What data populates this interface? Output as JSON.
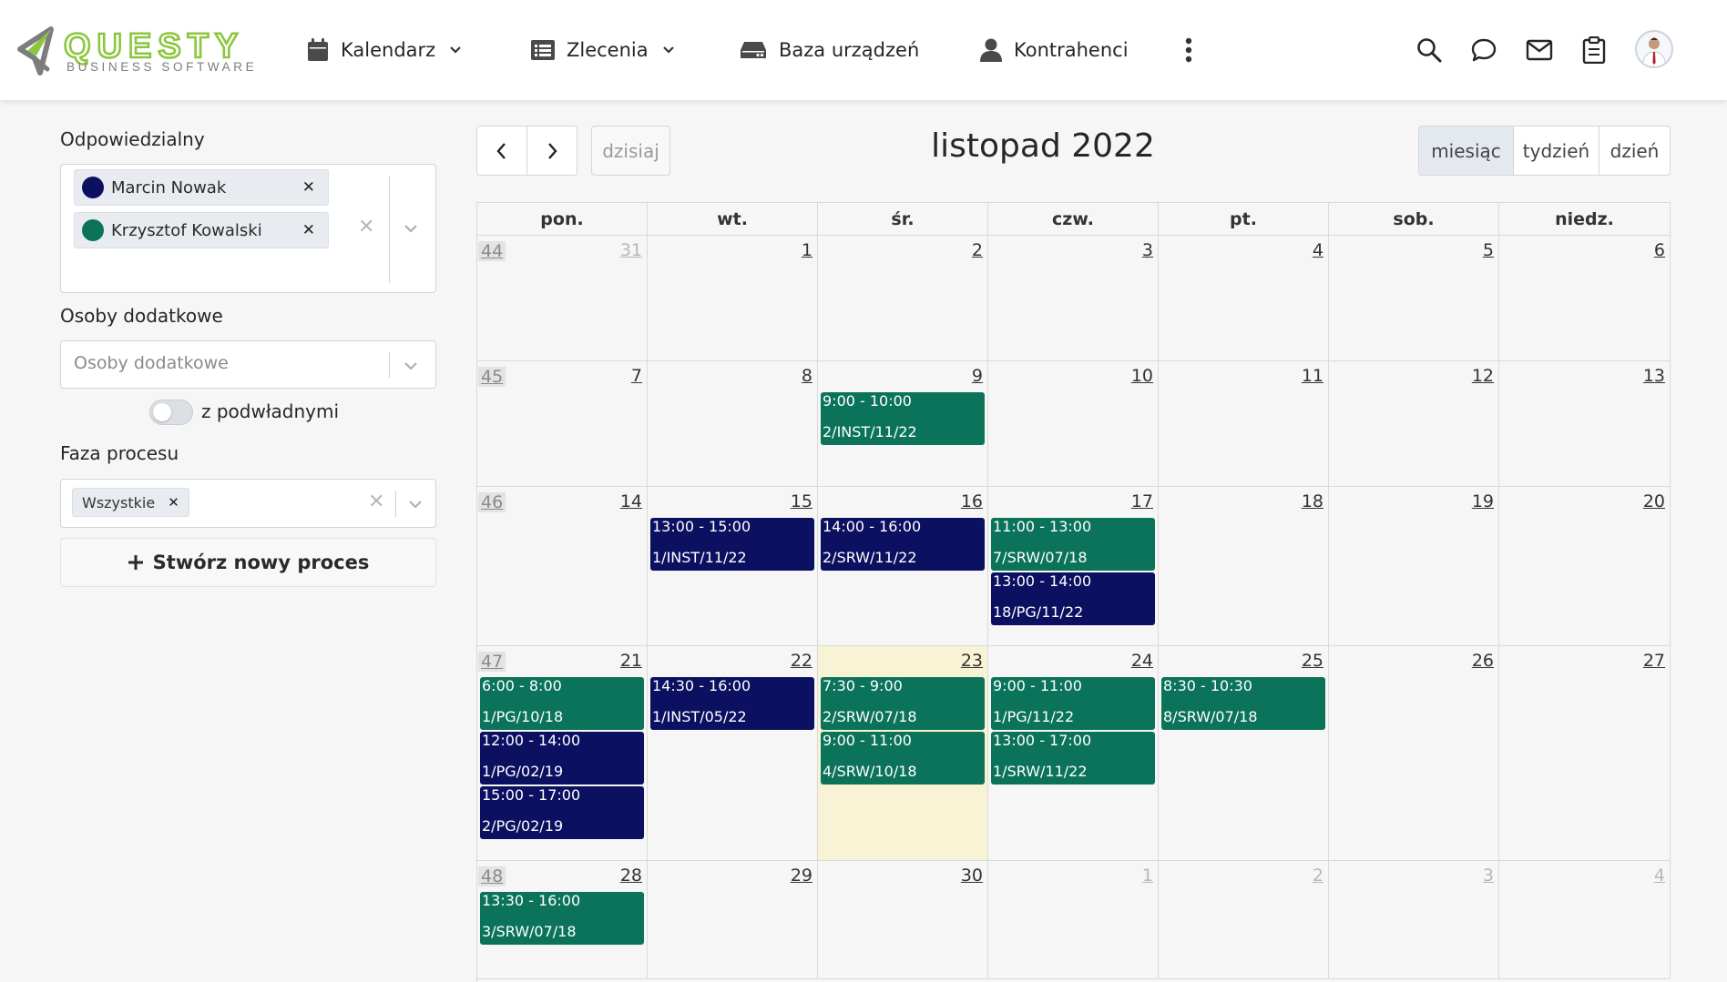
{
  "brand": {
    "name": "QUESTY",
    "tagline": "BUSINESS SOFTWARE",
    "green": "#8cc63f"
  },
  "nav": {
    "calendar": "Kalendarz",
    "orders": "Zlecenia",
    "devices": "Baza urządzeń",
    "contractors": "Kontrahenci"
  },
  "sidebar": {
    "responsible_label": "Odpowiedzialny",
    "responsible": [
      {
        "name": "Marcin Nowak",
        "color": "#0c1060"
      },
      {
        "name": "Krzysztof Kowalski",
        "color": "#0c735b"
      }
    ],
    "extra_people_label": "Osoby dodatkowe",
    "extra_people_placeholder": "Osoby dodatkowe",
    "subordinates_label": "z podwładnymi",
    "phase_label": "Faza procesu",
    "phase_tag": "Wszystkie",
    "create_button": "Stwórz nowy proces"
  },
  "toolbar": {
    "today": "dzisiaj",
    "title": "listopad 2022",
    "views": [
      "miesiąc",
      "tydzień",
      "dzień"
    ],
    "active_view": "miesiąc"
  },
  "calendar": {
    "days_of_week": [
      "pon.",
      "wt.",
      "śr.",
      "czw.",
      "pt.",
      "sob.",
      "niedz."
    ],
    "colors": {
      "green": "#0c735b",
      "navy": "#0c1060",
      "today": "#f9f3d6"
    },
    "weeks": [
      {
        "week": "44",
        "days": [
          {
            "d": "31",
            "other": true
          },
          {
            "d": "1"
          },
          {
            "d": "2"
          },
          {
            "d": "3"
          },
          {
            "d": "4"
          },
          {
            "d": "5"
          },
          {
            "d": "6"
          }
        ]
      },
      {
        "week": "45",
        "days": [
          {
            "d": "7"
          },
          {
            "d": "8"
          },
          {
            "d": "9",
            "events": [
              {
                "time": "9:00 - 10:00",
                "code": "2/INST/11/22",
                "color": "green"
              }
            ]
          },
          {
            "d": "10"
          },
          {
            "d": "11"
          },
          {
            "d": "12"
          },
          {
            "d": "13"
          }
        ]
      },
      {
        "week": "46",
        "days": [
          {
            "d": "14"
          },
          {
            "d": "15",
            "events": [
              {
                "time": "13:00 - 15:00",
                "code": "1/INST/11/22",
                "color": "navy"
              }
            ]
          },
          {
            "d": "16",
            "events": [
              {
                "time": "14:00 - 16:00",
                "code": "2/SRW/11/22",
                "color": "navy"
              }
            ]
          },
          {
            "d": "17",
            "events": [
              {
                "time": "11:00 - 13:00",
                "code": "7/SRW/07/18",
                "color": "green"
              },
              {
                "time": "13:00 - 14:00",
                "code": "18/PG/11/22",
                "color": "navy"
              }
            ]
          },
          {
            "d": "18"
          },
          {
            "d": "19"
          },
          {
            "d": "20"
          }
        ]
      },
      {
        "week": "47",
        "days": [
          {
            "d": "21",
            "events": [
              {
                "time": "6:00 - 8:00",
                "code": "1/PG/10/18",
                "color": "green"
              },
              {
                "time": "12:00 - 14:00",
                "code": "1/PG/02/19",
                "color": "navy"
              },
              {
                "time": "15:00 - 17:00",
                "code": "2/PG/02/19",
                "color": "navy"
              }
            ]
          },
          {
            "d": "22",
            "events": [
              {
                "time": "14:30 - 16:00",
                "code": "1/INST/05/22",
                "color": "navy"
              }
            ]
          },
          {
            "d": "23",
            "today": true,
            "events": [
              {
                "time": "7:30 - 9:00",
                "code": "2/SRW/07/18",
                "color": "green"
              },
              {
                "time": "9:00 - 11:00",
                "code": "4/SRW/10/18",
                "color": "green"
              }
            ]
          },
          {
            "d": "24",
            "events": [
              {
                "time": "9:00 - 11:00",
                "code": "1/PG/11/22",
                "color": "green"
              },
              {
                "time": "13:00 - 17:00",
                "code": "1/SRW/11/22",
                "color": "green"
              }
            ]
          },
          {
            "d": "25",
            "events": [
              {
                "time": "8:30 - 10:30",
                "code": "8/SRW/07/18",
                "color": "green"
              }
            ]
          },
          {
            "d": "26"
          },
          {
            "d": "27"
          }
        ]
      },
      {
        "week": "48",
        "days": [
          {
            "d": "28",
            "events": [
              {
                "time": "13:30 - 16:00",
                "code": "3/SRW/07/18",
                "color": "green"
              }
            ]
          },
          {
            "d": "29"
          },
          {
            "d": "30"
          },
          {
            "d": "1",
            "other": true
          },
          {
            "d": "2",
            "other": true
          },
          {
            "d": "3",
            "other": true
          },
          {
            "d": "4",
            "other": true
          }
        ]
      }
    ]
  }
}
